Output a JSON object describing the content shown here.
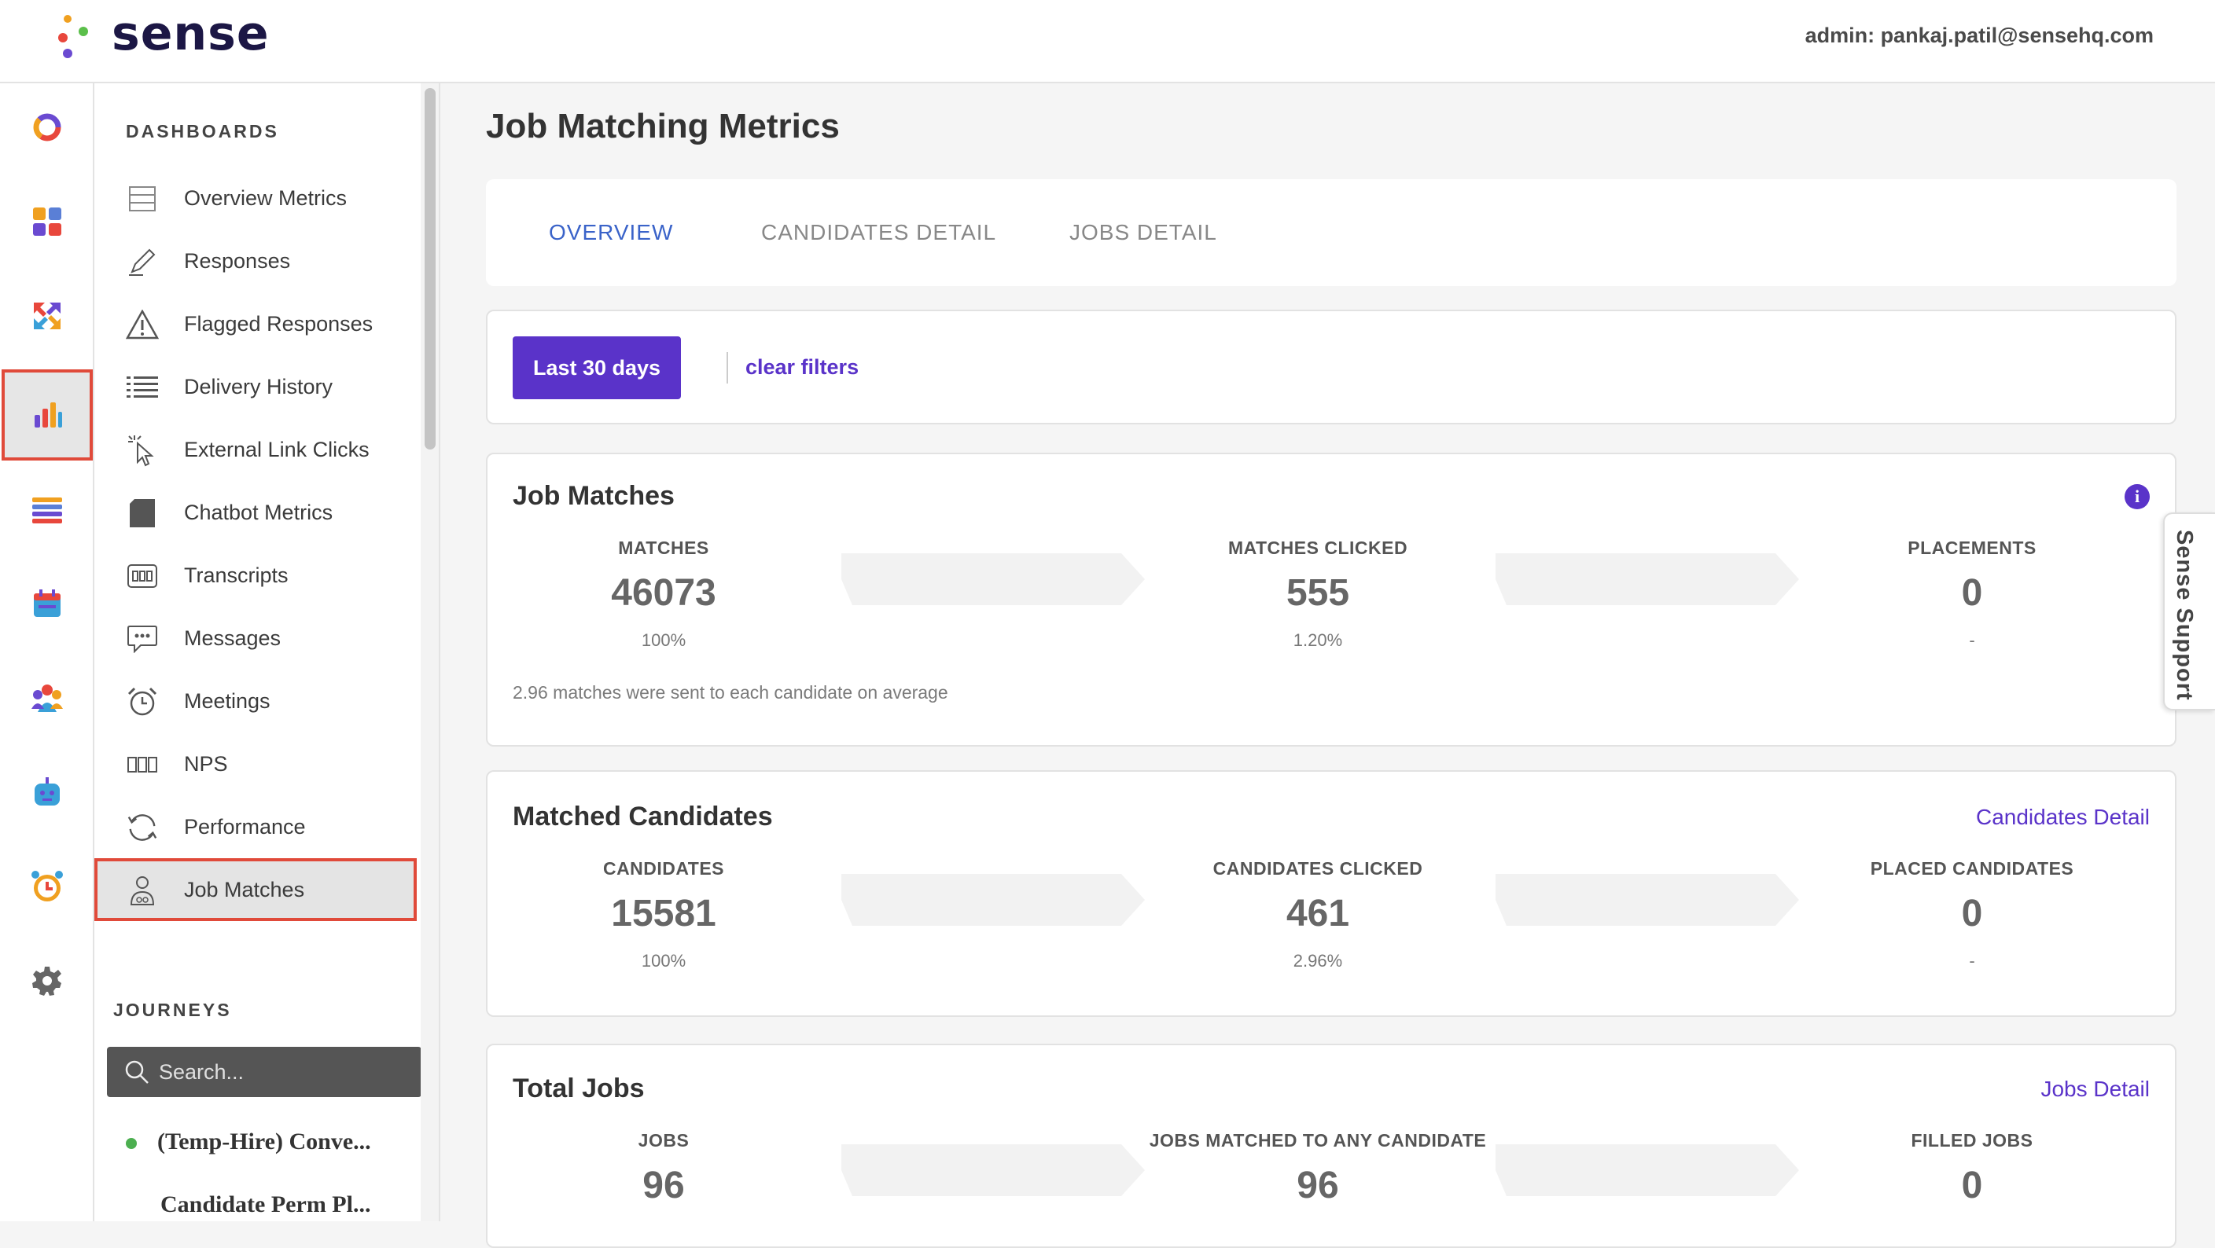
{
  "brand": {
    "name": "sense"
  },
  "header": {
    "admin_label": "admin: pankaj.patil@sensehq.com"
  },
  "rail": [
    {
      "icon": "donut-icon"
    },
    {
      "icon": "dashboard-grid-icon"
    },
    {
      "icon": "arrows-exchange-icon"
    },
    {
      "icon": "bar-chart-icon",
      "active": true
    },
    {
      "icon": "list-stack-icon"
    },
    {
      "icon": "calendar-icon"
    },
    {
      "icon": "people-icon"
    },
    {
      "icon": "chatbot-icon"
    },
    {
      "icon": "alarm-clock-icon"
    },
    {
      "icon": "gear-icon"
    }
  ],
  "sidebar": {
    "dashboards_heading": "DASHBOARDS",
    "items": [
      {
        "label": "Overview Metrics",
        "icon": "table-icon"
      },
      {
        "label": "Responses",
        "icon": "pencil-icon"
      },
      {
        "label": "Flagged Responses",
        "icon": "warning-icon"
      },
      {
        "label": "Delivery History",
        "icon": "list-icon"
      },
      {
        "label": "External Link Clicks",
        "icon": "click-pointer-icon"
      },
      {
        "label": "Chatbot Metrics",
        "icon": "chatbot-box-icon"
      },
      {
        "label": "Transcripts",
        "icon": "transcript-icon"
      },
      {
        "label": "Messages",
        "icon": "message-bubble-icon"
      },
      {
        "label": "Meetings",
        "icon": "alarm-icon"
      },
      {
        "label": "NPS",
        "icon": "nps-icon"
      },
      {
        "label": "Performance",
        "icon": "refresh-icon"
      },
      {
        "label": "Job Matches",
        "icon": "person-icon",
        "active": true
      }
    ],
    "journeys_heading": "JOURNEYS",
    "search_placeholder": "Search...",
    "journeys": [
      {
        "label": "(Temp-Hire) Conve...",
        "status": "active"
      },
      {
        "label": "Candidate Perm Pl..."
      }
    ]
  },
  "page": {
    "title": "Job Matching Metrics"
  },
  "tabs": [
    {
      "label": "OVERVIEW",
      "active": true
    },
    {
      "label": "CANDIDATES DETAIL"
    },
    {
      "label": "JOBS DETAIL"
    }
  ],
  "filters": {
    "range_label": "Last 30 days",
    "clear_label": "clear filters"
  },
  "job_matches": {
    "title": "Job Matches",
    "metrics": [
      {
        "label": "MATCHES",
        "value": "46073",
        "pct": "100%"
      },
      {
        "label": "MATCHES CLICKED",
        "value": "555",
        "pct": "1.20%"
      },
      {
        "label": "PLACEMENTS",
        "value": "0",
        "pct": "-"
      }
    ],
    "note": "2.96 matches were sent to each candidate on average"
  },
  "matched_candidates": {
    "title": "Matched Candidates",
    "link": "Candidates Detail",
    "metrics": [
      {
        "label": "CANDIDATES",
        "value": "15581",
        "pct": "100%"
      },
      {
        "label": "CANDIDATES CLICKED",
        "value": "461",
        "pct": "2.96%"
      },
      {
        "label": "PLACED CANDIDATES",
        "value": "0",
        "pct": "-"
      }
    ]
  },
  "total_jobs": {
    "title": "Total Jobs",
    "link": "Jobs Detail",
    "metrics": [
      {
        "label": "JOBS",
        "value": "96"
      },
      {
        "label": "JOBS MATCHED TO ANY CANDIDATE",
        "value": "96"
      },
      {
        "label": "FILLED JOBS",
        "value": "0"
      }
    ]
  },
  "support": {
    "label": "Sense Support"
  },
  "colors": {
    "accent": "#5a33c9",
    "tab_active": "#3a63c9",
    "highlight": "#e04a3a"
  }
}
